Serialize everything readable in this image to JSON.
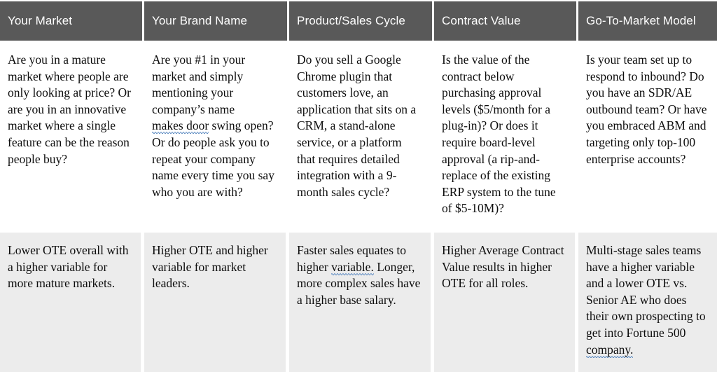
{
  "document": {
    "type": "comparison-matrix-table",
    "columns": 5,
    "body_rows": 2
  },
  "colors": {
    "header_background": "#595959",
    "header_text": "#ffffff",
    "row_questions_background": "#ffffff",
    "row_implications_background": "#ececec",
    "body_text": "#0d0d0d",
    "grammar_squiggle": "#4a7ebb",
    "divider": "#ffffff"
  },
  "header": {
    "cells": [
      {
        "label": "Your Market"
      },
      {
        "label": "Your Brand Name"
      },
      {
        "label": "Product/Sales Cycle"
      },
      {
        "label": "Contract Value"
      },
      {
        "label": "Go-To-Market Model"
      }
    ]
  },
  "rows": [
    {
      "name": "questions",
      "cells": [
        {
          "text": "Are you in a mature market where people are only looking at price? Or are you in an innovative market where a single feature can be the reason people buy?"
        },
        {
          "lead": "Are you #1 in your market and simply mentioning your company’s name ",
          "flagged": "makes door",
          "tail": " swing open? Or do people ask you to repeat your company name every time you say who you are with?"
        },
        {
          "text": "Do you sell a Google Chrome plugin that customers love, an application that sits on a CRM, a stand-alone service, or a platform that requires detailed integration with a 9-month sales cycle?"
        },
        {
          "text": "Is the value of the contract below purchasing approval levels ($5/month for a plug-in)? Or does it require board-level approval (a rip-and-replace of the existing ERP system to the tune of $5-10M)?"
        },
        {
          "text": "Is your team set up to respond to inbound? Do you have an SDR/AE outbound team? Or have you embraced ABM and targeting only top-100 enterprise accounts?"
        }
      ]
    },
    {
      "name": "implications",
      "cells": [
        {
          "text": "Lower OTE overall with a higher variable for more mature markets."
        },
        {
          "text": "Higher OTE and higher variable for market leaders."
        },
        {
          "lead": "Faster sales equates to higher ",
          "flagged": "variable.",
          "tail": " Longer, more complex sales have a higher base salary."
        },
        {
          "text": "Higher Average Contract Value results in higher OTE for all roles."
        },
        {
          "lead": "Multi-stage sales teams have a higher variable and a lower OTE vs. Senior AE who does their own prospecting to get into Fortune 500 ",
          "flagged": "company.",
          "tail": ""
        }
      ]
    }
  ]
}
